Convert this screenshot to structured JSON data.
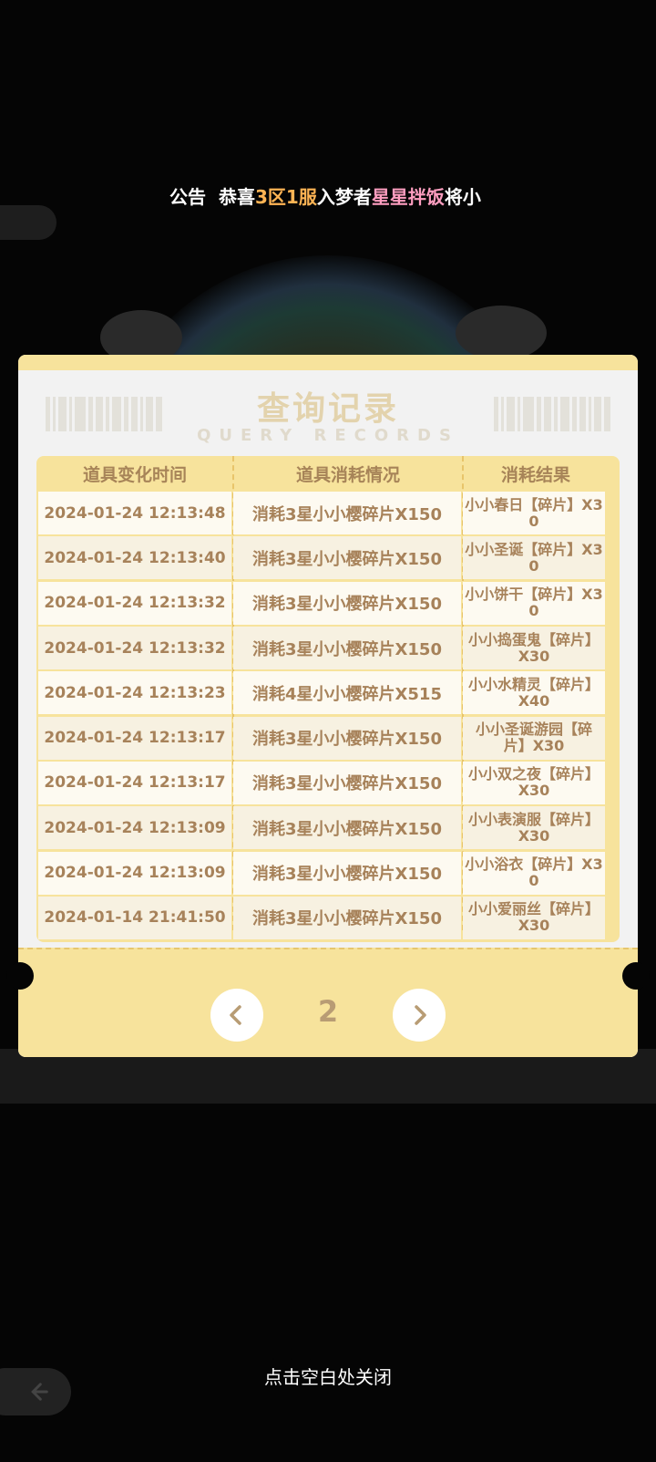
{
  "announcement": {
    "label": "公告",
    "segments": [
      {
        "text": "恭喜",
        "style": "w"
      },
      {
        "text": "3区",
        "style": "o"
      },
      {
        "text": "1服",
        "style": "o"
      },
      {
        "text": "入梦者",
        "style": "w"
      },
      {
        "text": "星星拌饭",
        "style": "p"
      },
      {
        "text": "将小",
        "style": "w"
      }
    ]
  },
  "dialog": {
    "title": "查询记录",
    "subtitle": "QUERY RECORDS",
    "columns": [
      "道具变化时间",
      "道具消耗情况",
      "消耗结果"
    ],
    "rows": [
      {
        "time": "2024-01-24 12:13:48",
        "consume": "消耗3星小小樱碎片X150",
        "result": "小小春日【碎片】X30"
      },
      {
        "time": "2024-01-24 12:13:40",
        "consume": "消耗3星小小樱碎片X150",
        "result": "小小圣诞【碎片】X30"
      },
      {
        "time": "2024-01-24 12:13:32",
        "consume": "消耗3星小小樱碎片X150",
        "result": "小小饼干【碎片】X30"
      },
      {
        "time": "2024-01-24 12:13:32",
        "consume": "消耗3星小小樱碎片X150",
        "result": "小小捣蛋鬼【碎片】X30"
      },
      {
        "time": "2024-01-24 12:13:23",
        "consume": "消耗4星小小樱碎片X515",
        "result": "小小水精灵【碎片】X40"
      },
      {
        "time": "2024-01-24 12:13:17",
        "consume": "消耗3星小小樱碎片X150",
        "result": "小小圣诞游园【碎片】X30"
      },
      {
        "time": "2024-01-24 12:13:17",
        "consume": "消耗3星小小樱碎片X150",
        "result": "小小双之夜【碎片】X30"
      },
      {
        "time": "2024-01-24 12:13:09",
        "consume": "消耗3星小小樱碎片X150",
        "result": "小小表演服【碎片】X30"
      },
      {
        "time": "2024-01-24 12:13:09",
        "consume": "消耗3星小小樱碎片X150",
        "result": "小小浴衣【碎片】X30"
      },
      {
        "time": "2024-01-14 21:41:50",
        "consume": "消耗3星小小樱碎片X150",
        "result": "小小爱丽丝【碎片】X30"
      }
    ],
    "pagination": {
      "current_page": "2",
      "prev_icon": "chevron-left-icon",
      "next_icon": "chevron-right-icon"
    }
  },
  "close_hint": "点击空白处关闭",
  "colors": {
    "accent_yellow": "#f7e39c",
    "text_brown": "#a7825a",
    "title_beige": "#e3d3ad"
  }
}
